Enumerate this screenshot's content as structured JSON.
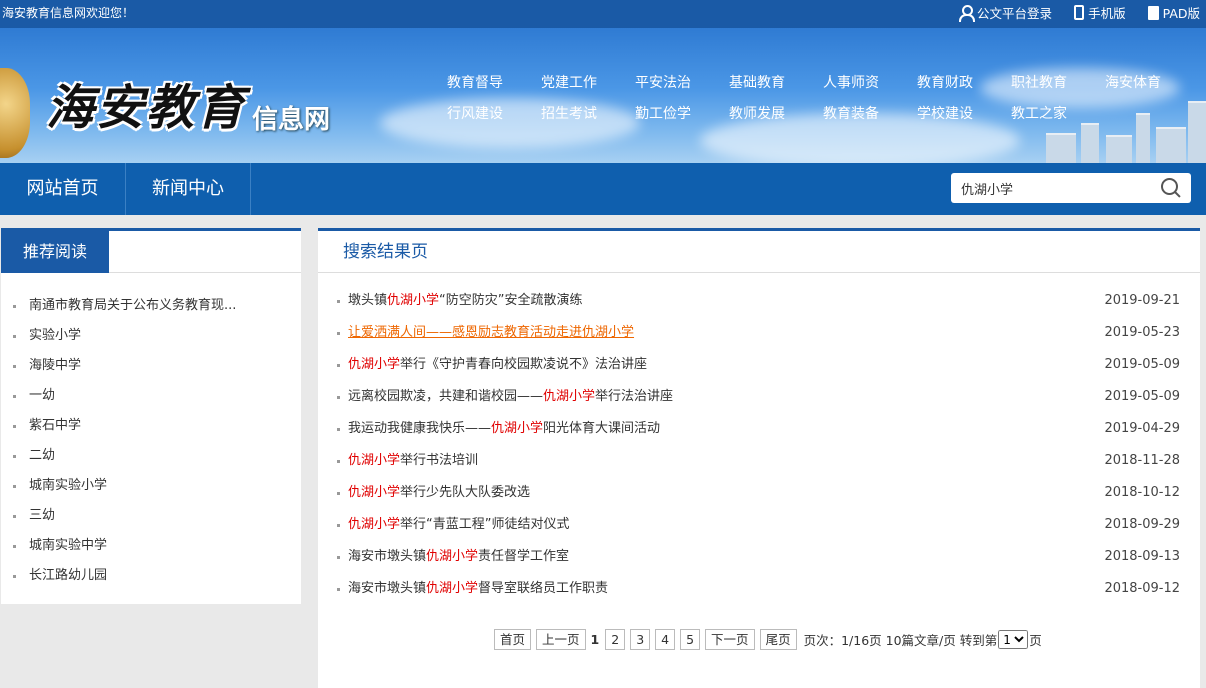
{
  "topbar": {
    "welcome": "海安教育信息网欢迎您！",
    "links": [
      {
        "label": "公文平台登录",
        "icon": "user-icon"
      },
      {
        "label": "手机版",
        "icon": "phone-icon"
      },
      {
        "label": "PAD版",
        "icon": "tablet-icon"
      }
    ]
  },
  "header": {
    "logo_text": "海安教育",
    "logo_sub": "信息网",
    "menu": [
      "教育督导",
      "党建工作",
      "平安法治",
      "基础教育",
      "人事师资",
      "教育财政",
      "职社教育",
      "海安体育",
      "行风建设",
      "招生考试",
      "勤工俭学",
      "教师发展",
      "教育装备",
      "学校建设",
      "教工之家"
    ]
  },
  "nav": {
    "tabs": [
      "网站首页",
      "新闻中心"
    ],
    "search_value": "仇湖小学"
  },
  "sidebar": {
    "title": "推荐阅读",
    "items": [
      "南通市教育局关于公布义务教育现...",
      "实验小学",
      "海陵中学",
      "一幼",
      "紫石中学",
      "二幼",
      "城南实验小学",
      "三幼",
      "城南实验中学",
      "长江路幼儿园"
    ]
  },
  "results": {
    "title": "搜索结果页",
    "items": [
      {
        "pre": "墩头镇",
        "hl": "仇湖小学",
        "post": "“防空防灾”安全疏散演练",
        "date": "2019-09-21"
      },
      {
        "pre": "让爱洒满人间——感恩励志教育活动走进",
        "hl": "仇湖小学",
        "post": "",
        "date": "2019-05-23"
      },
      {
        "pre": "",
        "hl": "仇湖小学",
        "post": "举行《守护青春向校园欺凌说不》法治讲座",
        "date": "2019-05-09"
      },
      {
        "pre": "远离校园欺凌，共建和谐校园——",
        "hl": "仇湖小学",
        "post": "举行法治讲座",
        "date": "2019-05-09"
      },
      {
        "pre": "我运动我健康我快乐——",
        "hl": "仇湖小学",
        "post": "阳光体育大课间活动",
        "date": "2019-04-29"
      },
      {
        "pre": "",
        "hl": "仇湖小学",
        "post": "举行书法培训",
        "date": "2018-11-28"
      },
      {
        "pre": "",
        "hl": "仇湖小学",
        "post": "举行少先队大队委改选",
        "date": "2018-10-12"
      },
      {
        "pre": "",
        "hl": "仇湖小学",
        "post": "举行“青蓝工程”师徒结对仪式",
        "date": "2018-09-29"
      },
      {
        "pre": "海安市墩头镇",
        "hl": "仇湖小学",
        "post": "责任督学工作室",
        "date": "2018-09-13"
      },
      {
        "pre": "海安市墩头镇",
        "hl": "仇湖小学",
        "post": "督导室联络员工作职责",
        "date": "2018-09-12"
      }
    ]
  },
  "pager": {
    "first": "首页",
    "prev": "上一页",
    "current": "1",
    "pages": [
      "2",
      "3",
      "4",
      "5"
    ],
    "next": "下一页",
    "last": "尾页",
    "info": "页次：1/16页 10篇文章/页 转到第",
    "select_value": "1",
    "suffix": "页"
  },
  "colors": {
    "brand_blue": "#1a5aa6",
    "nav_blue": "#0f5fae",
    "highlight_red": "#e00000",
    "hover_orange": "#ee6600"
  }
}
